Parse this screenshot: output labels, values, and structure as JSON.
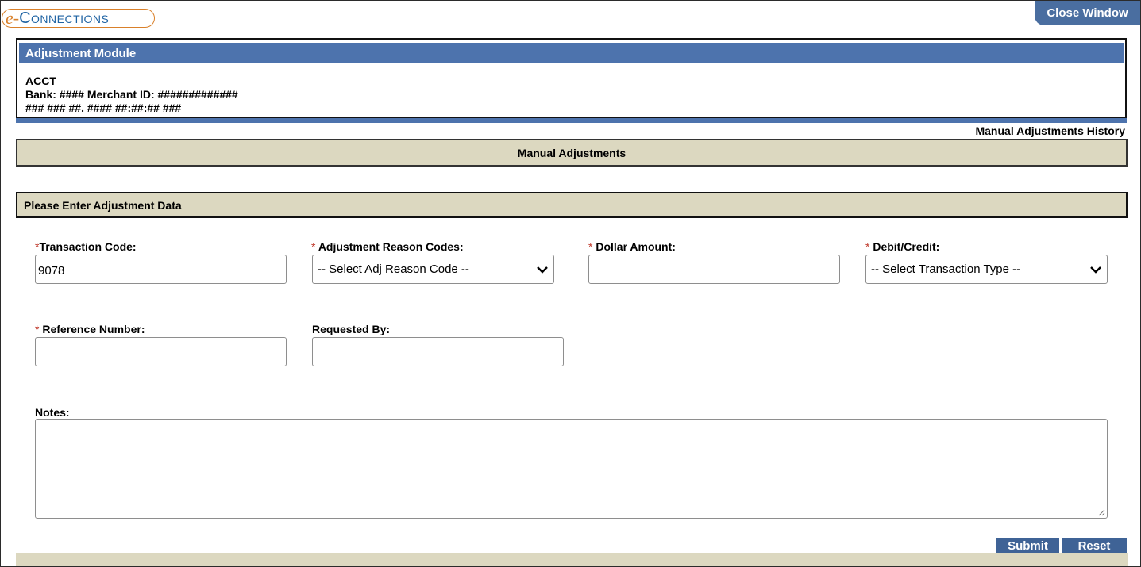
{
  "logo": {
    "prefix": "e-",
    "rest": "Connections"
  },
  "header": {
    "close_label": "Close Window"
  },
  "module": {
    "title": "Adjustment Module",
    "line1": "ACCT",
    "line2": "Bank: #### Merchant ID: #############",
    "line3": "### ### ##. #### ##:##:## ###"
  },
  "links": {
    "history": "Manual Adjustments History"
  },
  "sections": {
    "manual": "Manual Adjustments",
    "enter": "Please Enter Adjustment Data"
  },
  "form": {
    "required_mark": "*",
    "transaction_code": {
      "label": "Transaction Code:",
      "value": "9078"
    },
    "reason_codes": {
      "label": " Adjustment Reason Codes:",
      "selected": "-- Select Adj Reason Code --"
    },
    "dollar_amount": {
      "label": " Dollar Amount:",
      "value": ""
    },
    "debit_credit": {
      "label": " Debit/Credit:",
      "selected": "-- Select Transaction Type --"
    },
    "reference_number": {
      "label": " Reference Number:",
      "value": ""
    },
    "requested_by": {
      "label": "Requested By:",
      "value": ""
    },
    "notes": {
      "label": "Notes:",
      "value": ""
    }
  },
  "buttons": {
    "submit": "Submit",
    "reset": "Reset"
  },
  "colors": {
    "header_blue": "#4d73ad",
    "button_blue": "#3f6396",
    "section_beige": "#dcd8c0",
    "required_red": "#c0392b",
    "logo_orange": "#d9802a",
    "logo_blue": "#1f63a3"
  }
}
